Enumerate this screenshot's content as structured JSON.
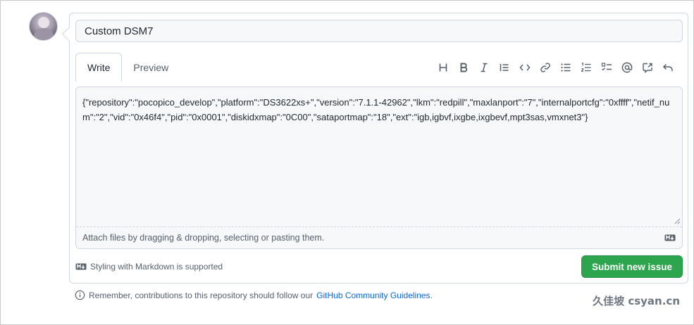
{
  "issue": {
    "title_value": "Custom DSM7",
    "tabs": [
      {
        "label": "Write",
        "active": true
      },
      {
        "label": "Preview",
        "active": false
      }
    ],
    "toolbar_icons": [
      "heading-icon",
      "bold-icon",
      "italic-icon",
      "quote-icon",
      "code-icon",
      "link-icon",
      "unordered-list-icon",
      "ordered-list-icon",
      "task-list-icon",
      "mention-icon",
      "reference-icon",
      "undo-icon"
    ],
    "body_value": "{\"repository\":\"pocopico_develop\",\"platform\":\"DS3622xs+\",\"version\":\"7.1.1-42962\",\"lkm\":\"redpill\",\"maxlanport\":\"7\",\"internalportcfg\":\"0xffff\",\"netif_num\":\"2\",\"vid\":\"0x46f4\",\"pid\":\"0x0001\",\"diskidxmap\":\"0C00\",\"sataportmap\":\"18\",\"ext\":\"igb,igbvf,ixgbe,ixgbevf,mpt3sas,vmxnet3\"}",
    "attach_hint": "Attach files by dragging & dropping, selecting or pasting them.",
    "markdown_hint": "Styling with Markdown is supported",
    "submit_label": "Submit new issue",
    "remember_text": "Remember, contributions to this repository should follow our",
    "guidelines_link": "GitHub Community Guidelines",
    "period": "."
  },
  "watermark": "久佳坡 csyan.cn",
  "colors": {
    "submit": "#2da44e",
    "link": "#0969da"
  }
}
